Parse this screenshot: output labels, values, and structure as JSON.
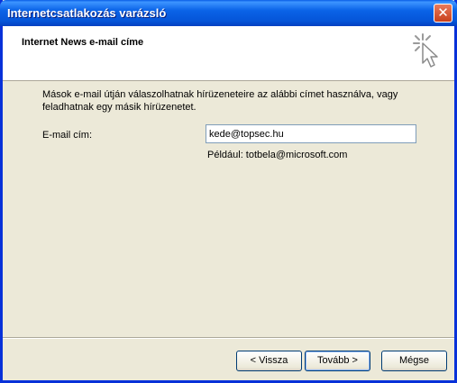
{
  "window": {
    "title": "Internetcsatlakozás varázsló",
    "close_glyph": "✕"
  },
  "header": {
    "title": "Internet News e-mail címe",
    "icon": "wizard-cursor-icon"
  },
  "content": {
    "description": "Mások e-mail útján válaszolhatnak hírüzeneteire az alábbi címet használva, vagy feladhatnak egy másik hírüzenetet.",
    "email_label": "E-mail cím:",
    "email_value": "kede@topsec.hu",
    "example": "Például: totbela@microsoft.com"
  },
  "buttons": {
    "back": "< Vissza",
    "next": "Tovább >",
    "cancel": "Mégse"
  }
}
